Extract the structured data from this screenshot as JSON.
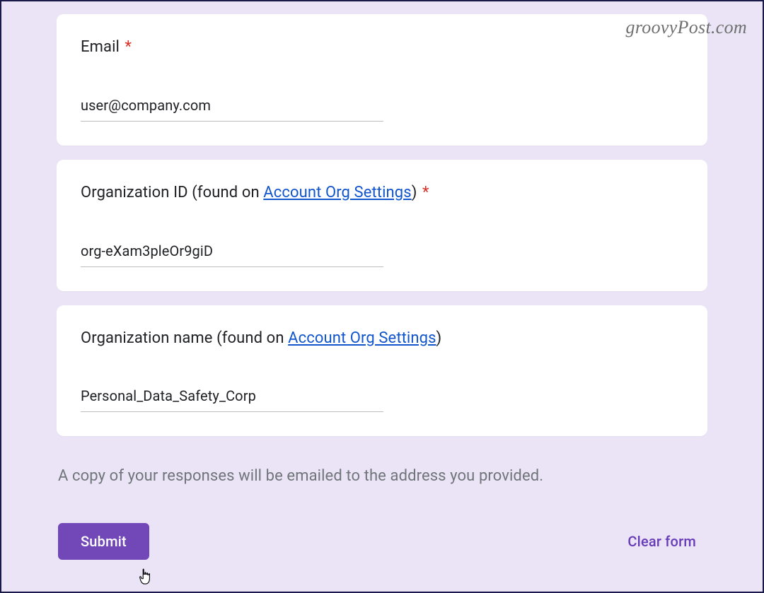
{
  "watermark": "groovyPost.com",
  "fields": {
    "email": {
      "label": "Email",
      "required_marker": "*",
      "value": "user@company.com"
    },
    "org_id": {
      "label_before": "Organization ID (found on ",
      "link_text": "Account Org Settings",
      "label_after": ")",
      "required_marker": "*",
      "value": "org-eXam3pleOr9giD"
    },
    "org_name": {
      "label_before": "Organization name (found on ",
      "link_text": "Account Org Settings",
      "label_after": ")",
      "value": "Personal_Data_Safety_Corp"
    }
  },
  "disclosure": "A copy of your responses will be emailed to the address you provided.",
  "actions": {
    "submit": "Submit",
    "clear": "Clear form"
  }
}
